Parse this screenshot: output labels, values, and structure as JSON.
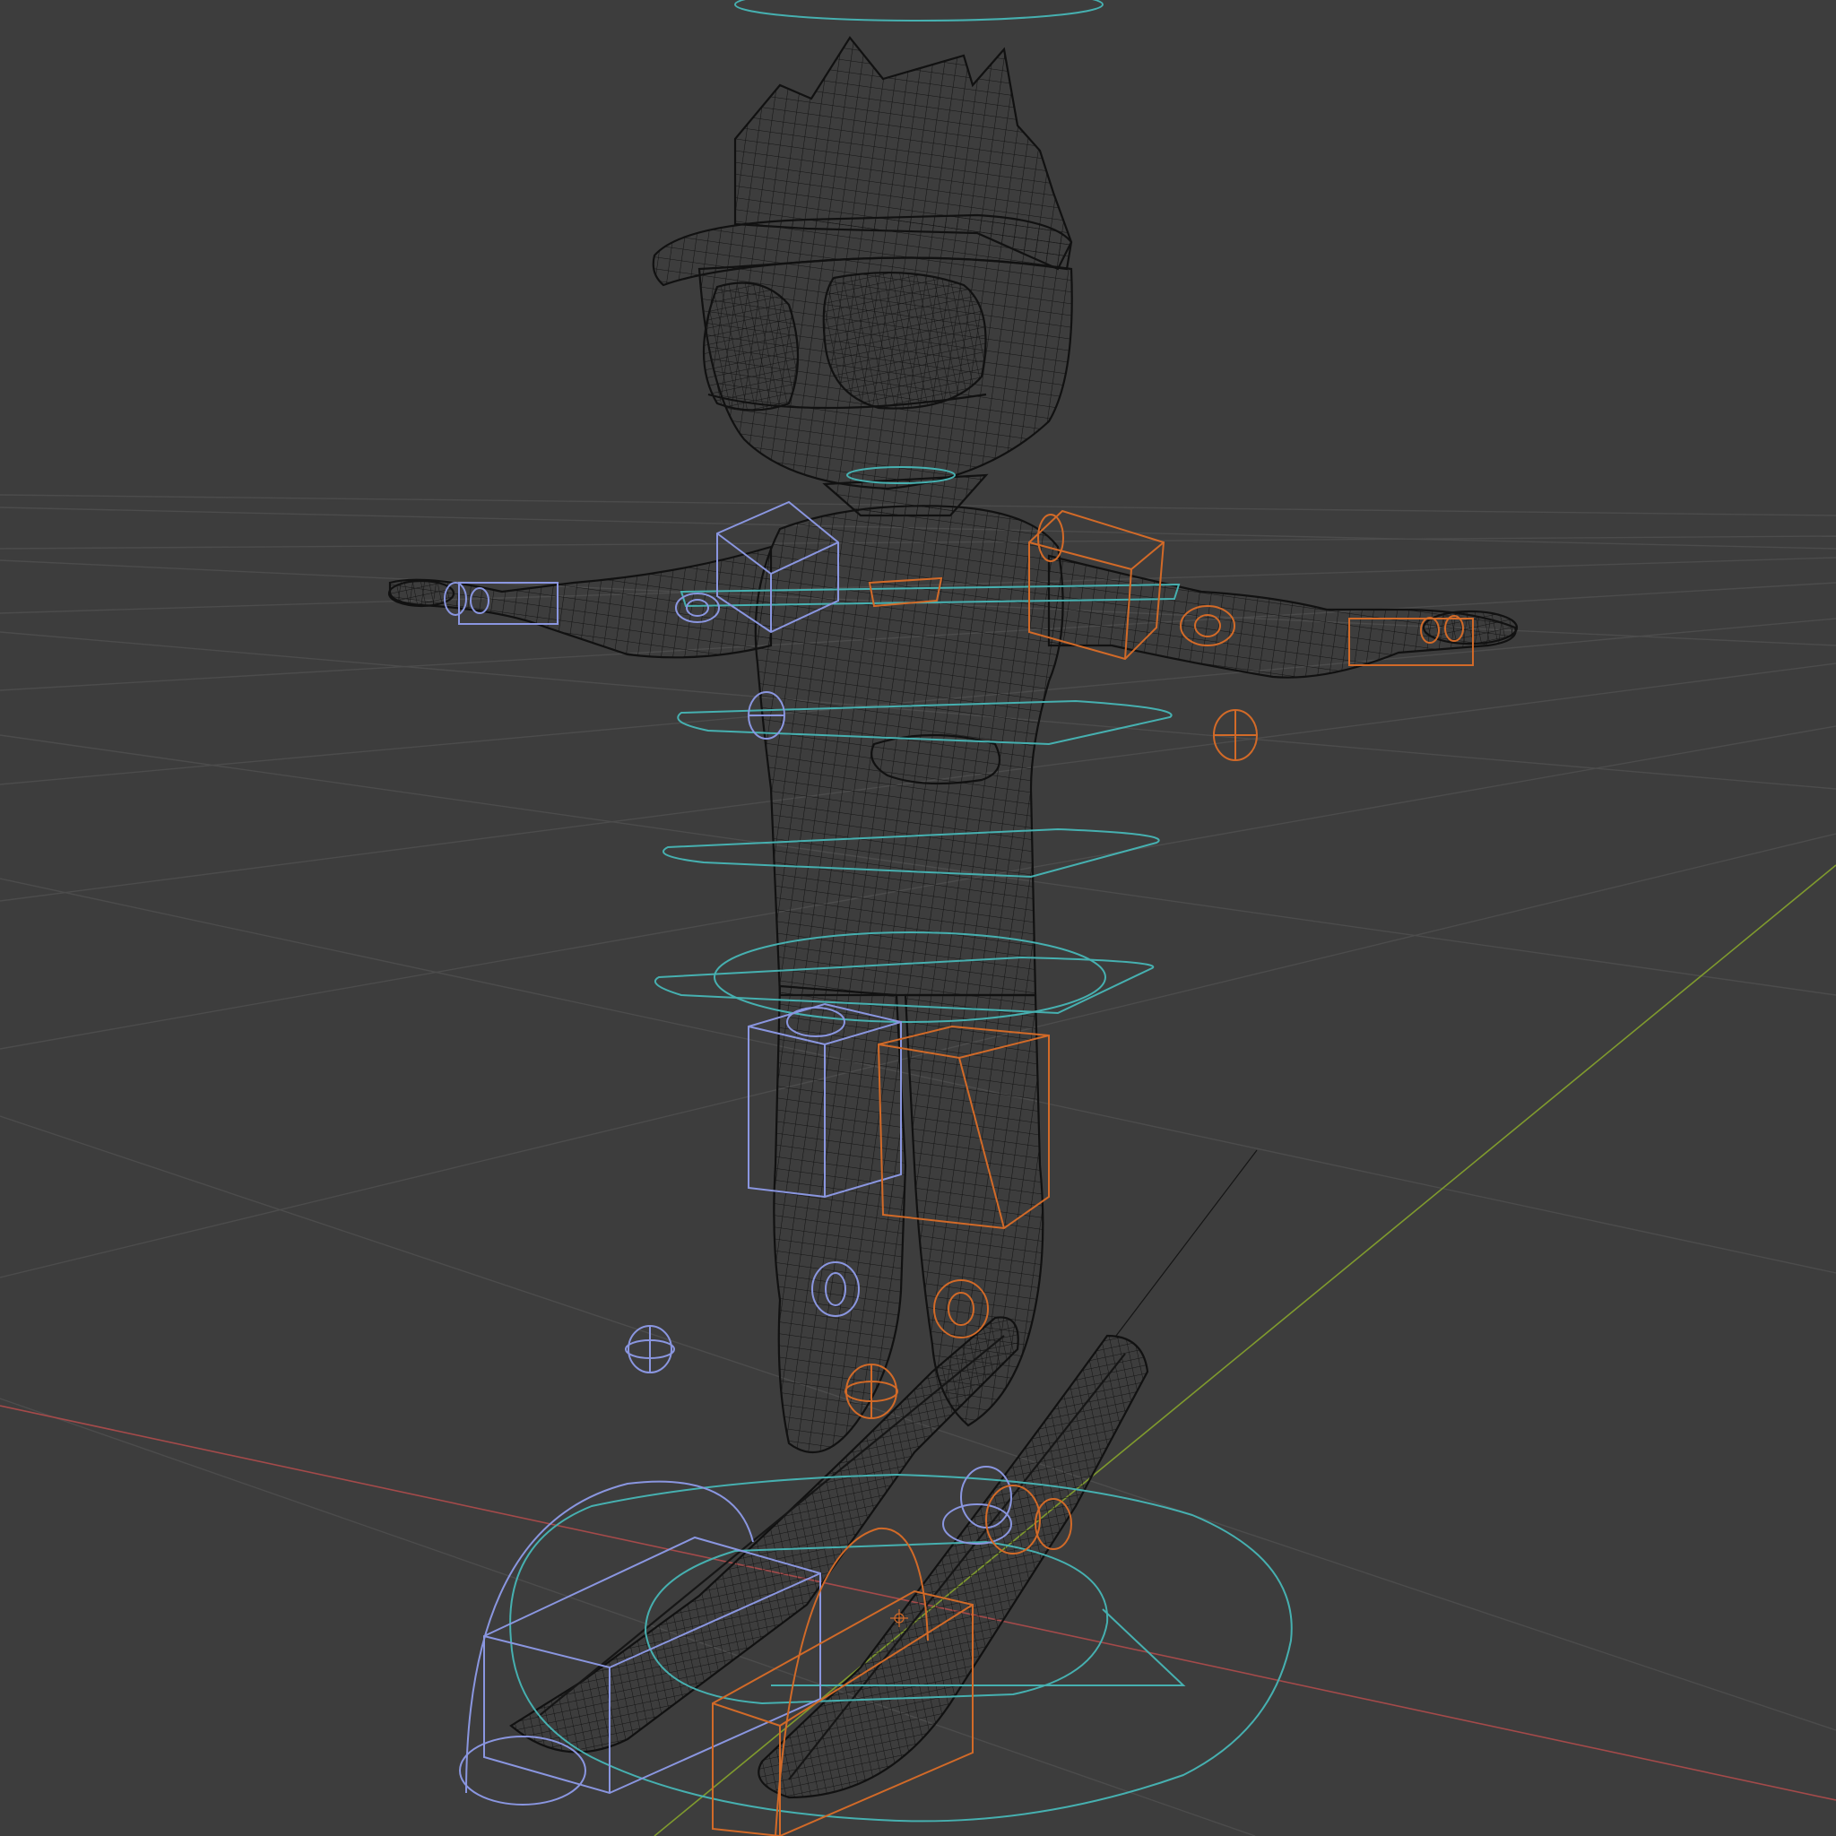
{
  "viewport": {
    "mode": "wireframe",
    "background": "#3d3d3d"
  },
  "grid": {
    "color": "#4a4a4a",
    "axis_x_color": "#a44a4a",
    "axis_y_color": "#7f9a2e"
  },
  "model": {
    "subject": "cartoon-skier-character",
    "pose": "t-pose",
    "wire_color": "#0f0f0f"
  },
  "rig": {
    "center_controls_color": "#46b0b0",
    "left_controls_color": "#8a96e0",
    "right_controls_color": "#d26a28",
    "controls": [
      "root-control",
      "hips-control",
      "spine-control",
      "chest-control",
      "shoulders-control",
      "neck-control",
      "head-control",
      "shoulder-left-control",
      "shoulder-right-control",
      "hand-left-control",
      "hand-right-control",
      "elbow-left-control",
      "elbow-right-control",
      "thigh-left-control",
      "thigh-right-control",
      "knee-left-control",
      "knee-right-control",
      "foot-left-control",
      "foot-right-control"
    ]
  }
}
